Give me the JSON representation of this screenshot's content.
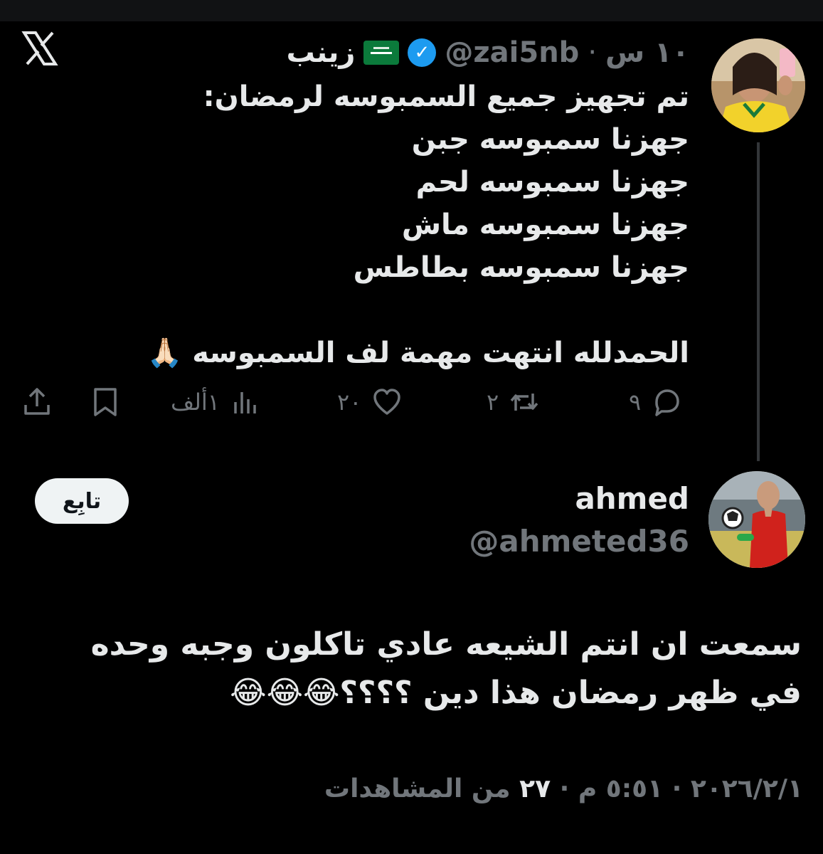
{
  "tweet1": {
    "author_name": "زينب",
    "handle": "@zai5nb",
    "separator": "·",
    "time": "١٠ س",
    "lines": [
      "تم تجهيز جميع السمبوسه لرمضان:",
      "جهزنا سمبوسه جبن",
      "جهزنا سمبوسه لحم",
      "جهزنا سمبوسه ماش",
      "جهزنا سمبوسه بطاطس",
      "",
      "الحمدلله انتهت مهمة لف السمبوسه 🙏🏻"
    ],
    "actions": {
      "replies": "٩",
      "retweets": "٢",
      "likes": "٢٠",
      "views": "١ألف"
    }
  },
  "tweet2": {
    "author_name": "ahmed",
    "handle": "@ahmeted36",
    "follow_label": "تابِع",
    "lines": [
      "سمعت ان انتم الشيعه عادي تاكلون وجبه وحده",
      "في ظهر رمضان هذا دين ؟؟؟؟😂😂😂"
    ],
    "meta": {
      "date": "٢٠٢٦/٢/١",
      "time": "٥:٥١ م",
      "views_count": "٢٧",
      "views_label": "من المشاهدات",
      "separator": "·"
    }
  },
  "colors": {
    "background": "#000000",
    "text": "#e7e9ea",
    "muted": "#71767b",
    "verified": "#1d9bf0"
  }
}
